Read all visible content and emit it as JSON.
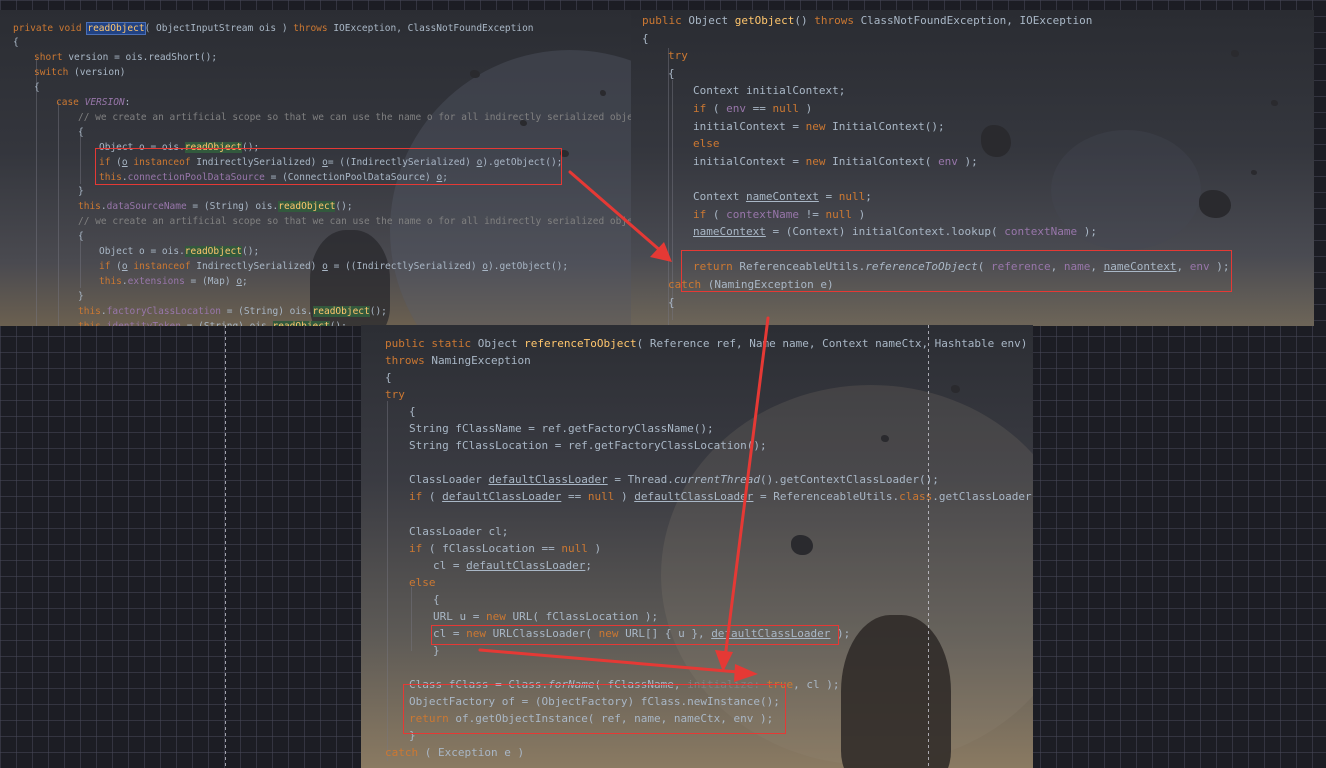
{
  "panels": {
    "read_object": {
      "lines": [
        [
          [
            "kw",
            "private void "
          ],
          [
            "fn hlb",
            "readObject"
          ],
          [
            "",
            "( ObjectInputStream ois ) "
          ],
          [
            "kw",
            "throws "
          ],
          [
            "",
            "IOException, ClassNotFoundException"
          ]
        ],
        [
          [
            "",
            "{"
          ]
        ],
        [
          [
            "kw",
            "short "
          ],
          [
            "",
            "version = ois.readShort();"
          ]
        ],
        [
          [
            "kw",
            "switch "
          ],
          [
            "",
            "(version)"
          ]
        ],
        [
          [
            "",
            "{"
          ]
        ],
        [
          [
            "kw",
            "case "
          ],
          [
            "fd it",
            "VERSION"
          ],
          [
            "",
            ":"
          ]
        ],
        [
          [
            "cm",
            "// we create an artificial scope so that we can use the name o for all indirectly serialized objects."
          ]
        ],
        [
          [
            "",
            "{"
          ]
        ],
        [
          [
            "",
            "Object o = ois."
          ],
          [
            "fn hlg",
            "readObject"
          ],
          [
            "",
            "();"
          ]
        ],
        [
          [
            "kw",
            "if "
          ],
          [
            "",
            "("
          ],
          [
            "ul",
            "o"
          ],
          [
            "kw",
            " instanceof "
          ],
          [
            "",
            "IndirectlySerialized) "
          ],
          [
            "ul",
            "o"
          ],
          [
            "",
            ""
          ],
          [
            "",
            "= ((IndirectlySerialized) "
          ],
          [
            "ul",
            "o"
          ],
          [
            "",
            ").getObject();"
          ]
        ],
        [
          [
            "kw",
            "this"
          ],
          [
            "",
            "."
          ],
          [
            "fd",
            "connectionPoolDataSource"
          ],
          [
            "",
            " = (ConnectionPoolDataSource) "
          ],
          [
            "ul",
            "o"
          ],
          [
            "",
            ";"
          ]
        ],
        [
          [
            "",
            "}"
          ]
        ],
        [
          [
            "kw",
            "this"
          ],
          [
            "",
            "."
          ],
          [
            "fd",
            "dataSourceName"
          ],
          [
            "",
            " = (String) ois."
          ],
          [
            "fn hlg",
            "readObject"
          ],
          [
            "",
            "();"
          ]
        ],
        [
          [
            "cm",
            "// we create an artificial scope so that we can use the name o for all indirectly serialized objects."
          ]
        ],
        [
          [
            "",
            "{"
          ]
        ],
        [
          [
            "",
            "Object o = ois."
          ],
          [
            "fn hlg",
            "readObject"
          ],
          [
            "",
            "();"
          ]
        ],
        [
          [
            "kw",
            "if "
          ],
          [
            "",
            "("
          ],
          [
            "ul",
            "o"
          ],
          [
            "kw",
            " instanceof "
          ],
          [
            "",
            "IndirectlySerialized) "
          ],
          [
            "ul",
            "o"
          ],
          [
            "",
            " = ((IndirectlySerialized) "
          ],
          [
            "ul",
            "o"
          ],
          [
            "",
            ").getObject();"
          ]
        ],
        [
          [
            "kw",
            "this"
          ],
          [
            "",
            "."
          ],
          [
            "fd",
            "extensions"
          ],
          [
            "",
            " = (Map) "
          ],
          [
            "ul",
            "o"
          ],
          [
            "",
            ";"
          ]
        ],
        [
          [
            "",
            "}"
          ]
        ],
        [
          [
            "kw",
            "this"
          ],
          [
            "",
            "."
          ],
          [
            "fd",
            "factoryClassLocation"
          ],
          [
            "",
            " = (String) ois."
          ],
          [
            "fn hlg",
            "readObject"
          ],
          [
            "",
            "();"
          ]
        ],
        [
          [
            "kw",
            "this"
          ],
          [
            "",
            "."
          ],
          [
            "fd",
            "identityToken"
          ],
          [
            "",
            " = (String) ois."
          ],
          [
            "fn hlg",
            "readObject"
          ],
          [
            "",
            "();"
          ]
        ]
      ]
    },
    "get_object": {
      "lines": [
        [
          [
            "kw",
            "public "
          ],
          [
            "",
            "Object "
          ],
          [
            "fn",
            "getObject"
          ],
          [
            "",
            "() "
          ],
          [
            "kw",
            "throws "
          ],
          [
            "",
            "ClassNotFoundException, IOException"
          ]
        ],
        [
          [
            "",
            "{"
          ]
        ],
        [
          [
            "kw",
            "try"
          ]
        ],
        [
          [
            "",
            "{"
          ]
        ],
        [
          [
            "",
            "Context initialContext;"
          ]
        ],
        [
          [
            "kw",
            "if "
          ],
          [
            "",
            "( "
          ],
          [
            "fd",
            "env"
          ],
          [
            "",
            " == "
          ],
          [
            "kw",
            "null"
          ],
          [
            "",
            " )"
          ]
        ],
        [
          [
            "",
            "initialContext = "
          ],
          [
            "kw",
            "new "
          ],
          [
            "",
            "InitialContext();"
          ]
        ],
        [
          [
            "kw",
            "else"
          ]
        ],
        [
          [
            "",
            "initialContext = "
          ],
          [
            "kw",
            "new "
          ],
          [
            "",
            "InitialContext( "
          ],
          [
            "fd",
            "env"
          ],
          [
            "",
            " );"
          ]
        ],
        [
          [
            "",
            ""
          ]
        ],
        [
          [
            "",
            "Context "
          ],
          [
            "ul",
            "nameContext"
          ],
          [
            "",
            " = "
          ],
          [
            "kw",
            "null"
          ],
          [
            "",
            ";"
          ]
        ],
        [
          [
            "kw",
            "if "
          ],
          [
            "",
            "( "
          ],
          [
            "fd",
            "contextName"
          ],
          [
            "",
            " != "
          ],
          [
            "kw",
            "null"
          ],
          [
            "",
            " )"
          ]
        ],
        [
          [
            "ul",
            "nameContext"
          ],
          [
            "",
            " = (Context) initialContext.lookup( "
          ],
          [
            "fd",
            "contextName"
          ],
          [
            "",
            " );"
          ]
        ],
        [
          [
            "",
            ""
          ]
        ],
        [
          [
            "kw",
            "return "
          ],
          [
            "",
            "ReferenceableUtils."
          ],
          [
            "it",
            "referenceToObject"
          ],
          [
            "",
            "( "
          ],
          [
            "fd",
            "reference"
          ],
          [
            "",
            ", "
          ],
          [
            "fd",
            "name"
          ],
          [
            "",
            ", "
          ],
          [
            "ul",
            "nameContext"
          ],
          [
            "",
            ", "
          ],
          [
            "fd",
            "env"
          ],
          [
            "",
            " );"
          ]
        ],
        [
          [
            "kw",
            "catch "
          ],
          [
            "",
            "(NamingException e)"
          ]
        ],
        [
          [
            "",
            "{"
          ]
        ]
      ]
    },
    "reference_to_object": {
      "lines": [
        [
          [
            "kw",
            "public static "
          ],
          [
            "",
            "Object "
          ],
          [
            "fn",
            "referenceToObject"
          ],
          [
            "",
            "( Reference ref, Name name, Context nameCtx, Hashtable env)"
          ]
        ],
        [
          [
            "kw",
            "throws "
          ],
          [
            "",
            "NamingException"
          ]
        ],
        [
          [
            "",
            "{"
          ]
        ],
        [
          [
            "kw",
            "try"
          ]
        ],
        [
          [
            "",
            "{"
          ]
        ],
        [
          [
            "",
            "String fClassName = ref.getFactoryClassName();"
          ]
        ],
        [
          [
            "",
            "String fClassLocation = ref.getFactoryClassLocation();"
          ]
        ],
        [
          [
            "",
            ""
          ]
        ],
        [
          [
            "",
            "ClassLoader "
          ],
          [
            "ul",
            "defaultClassLoader"
          ],
          [
            "",
            " = Thread."
          ],
          [
            "it",
            "currentThread"
          ],
          [
            "",
            "().getContextClassLoader();"
          ]
        ],
        [
          [
            "kw",
            "if "
          ],
          [
            "",
            "( "
          ],
          [
            "ul",
            "defaultClassLoader"
          ],
          [
            "",
            " == "
          ],
          [
            "kw",
            "null"
          ],
          [
            "",
            " ) "
          ],
          [
            "ul",
            "defaultClassLoader"
          ],
          [
            "",
            " = ReferenceableUtils."
          ],
          [
            "kw",
            "class"
          ],
          [
            "",
            ".getClassLoader();"
          ]
        ],
        [
          [
            "",
            ""
          ]
        ],
        [
          [
            "",
            "ClassLoader cl;"
          ]
        ],
        [
          [
            "kw",
            "if "
          ],
          [
            "",
            "( fClassLocation == "
          ],
          [
            "kw",
            "null"
          ],
          [
            "",
            " )"
          ]
        ],
        [
          [
            "",
            "cl = "
          ],
          [
            "ul",
            "defaultClassLoader"
          ],
          [
            "",
            ";"
          ]
        ],
        [
          [
            "kw",
            "else"
          ]
        ],
        [
          [
            "",
            "{"
          ]
        ],
        [
          [
            "",
            "URL u = "
          ],
          [
            "kw",
            "new "
          ],
          [
            "",
            "URL( fClassLocation );"
          ]
        ],
        [
          [
            "",
            "cl = "
          ],
          [
            "kw",
            "new "
          ],
          [
            "",
            "URLClassLoader( "
          ],
          [
            "kw",
            "new "
          ],
          [
            "",
            "URL[] { u }, "
          ],
          [
            "ul",
            "defaultClassLoader"
          ],
          [
            "",
            " );"
          ]
        ],
        [
          [
            "",
            "}"
          ]
        ],
        [
          [
            "",
            ""
          ]
        ],
        [
          [
            "",
            "Class fClass = Class."
          ],
          [
            "it",
            "forName"
          ],
          [
            "",
            "( fClassName, "
          ],
          [
            "cm",
            "initialize: "
          ],
          [
            "kw",
            "true"
          ],
          [
            "",
            ", cl );"
          ]
        ],
        [
          [
            "",
            "ObjectFactory of = (ObjectFactory) fClass.newInstance();"
          ]
        ],
        [
          [
            "kw",
            "return "
          ],
          [
            "",
            "of.getObjectInstance( ref, name, nameCtx, env );"
          ]
        ],
        [
          [
            "",
            "}"
          ]
        ],
        [
          [
            "kw",
            "catch "
          ],
          [
            "",
            "( Exception e )"
          ]
        ]
      ]
    }
  },
  "colors": {
    "keyword": "#cc7832",
    "method": "#ffc66d",
    "field": "#9876aa",
    "comment": "#808080",
    "text": "#a9b7c6",
    "annotation_red": "#e53935"
  }
}
